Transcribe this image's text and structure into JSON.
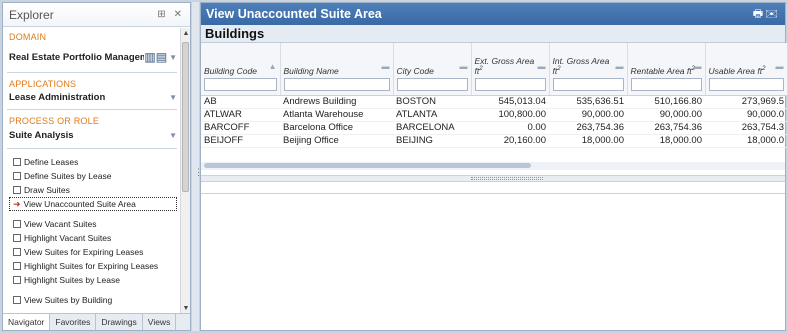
{
  "explorer": {
    "title": "Explorer",
    "domain_label": "DOMAIN",
    "domain_value": "Real Estate Portfolio Managemen",
    "applications_label": "APPLICATIONS",
    "application_value": "Lease Administration",
    "process_label": "PROCESS OR ROLE",
    "process_value": "Suite Analysis",
    "tasks_group1": [
      {
        "label": "Define Leases"
      },
      {
        "label": "Define Suites by Lease"
      },
      {
        "label": "Draw Suites"
      }
    ],
    "active_task": "View Unaccounted Suite Area",
    "tasks_group2": [
      {
        "label": "View Vacant Suites"
      },
      {
        "label": "Highlight Vacant Suites"
      },
      {
        "label": "View Suites for Expiring Leases"
      },
      {
        "label": "Highlight Suites for Expiring Leases"
      },
      {
        "label": "Highlight Suites by Lease"
      }
    ],
    "tasks_group3": [
      {
        "label": "View Suites by Building"
      }
    ],
    "tabs": [
      "Navigator",
      "Favorites",
      "Drawings",
      "Views"
    ]
  },
  "main": {
    "title": "View Unaccounted Suite Area",
    "grid_title": "Buildings",
    "columns": [
      "Building Code",
      "Building Name",
      "City Code",
      "Ext. Gross Area",
      "Int. Gross Area",
      "Rentable Area",
      "Usable Area"
    ],
    "area_unit": "ft",
    "rows": [
      [
        "AB",
        "Andrews Building",
        "BOSTON",
        "545,013.04",
        "535,636.51",
        "510,166.80",
        "273,969.5"
      ],
      [
        "ATLWAR",
        "Atlanta Warehouse",
        "ATLANTA",
        "100,800.00",
        "90,000.00",
        "90,000.00",
        "90,000.0"
      ],
      [
        "BARCOFF",
        "Barcelona Office",
        "BARCELONA",
        "0.00",
        "263,754.36",
        "263,754.36",
        "263,754.3"
      ],
      [
        "BEIJOFF",
        "Beijing Office",
        "BEIJING",
        "20,160.00",
        "18,000.00",
        "18,000.00",
        "18,000.0"
      ]
    ]
  }
}
